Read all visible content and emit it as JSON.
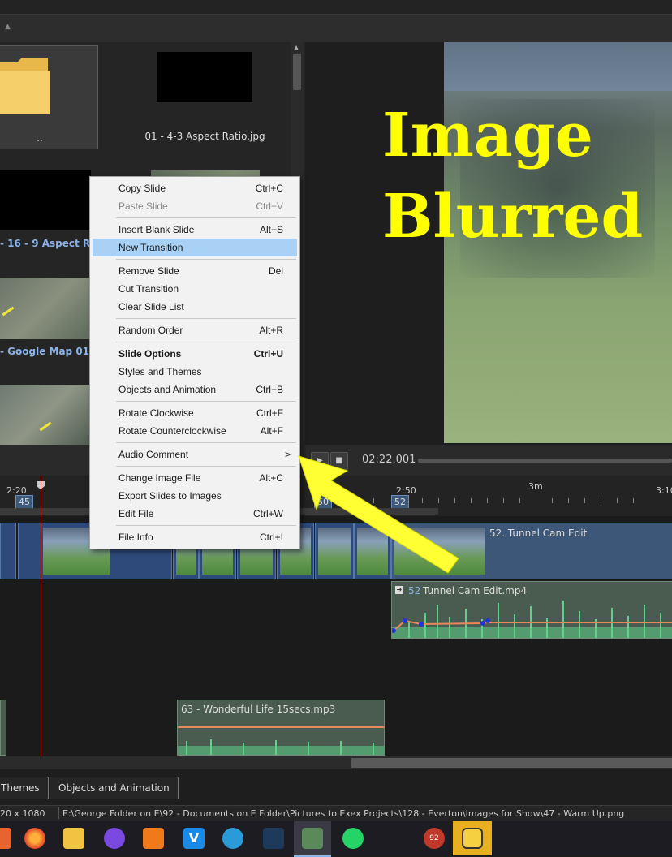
{
  "browser": {
    "tiles": [
      {
        "caption": ".."
      },
      {
        "caption": "01 - 4-3 Aspect Ratio.jpg"
      },
      {
        "caption": "- 16 - 9 Aspect Rati..."
      },
      {
        "caption": "- Google Map 01 L..."
      }
    ]
  },
  "preview": {
    "line1": "Image",
    "line2": "Blurred"
  },
  "player": {
    "timecode": "02:22.001",
    "play_icon": "play-icon",
    "stop_icon": "stop-icon"
  },
  "ruler": {
    "labels": [
      "2:20",
      "2:50",
      "3m",
      "3:10"
    ],
    "markers": [
      "45",
      "50",
      "52"
    ]
  },
  "timeline": {
    "slide_52_title": "52. Tunnel Cam Edit",
    "video_clip_number": "52",
    "video_clip_name": "Tunnel Cam Edit.mp4",
    "music_clip": "63 - Wonderful Life 15secs.mp3"
  },
  "bottom_tabs": {
    "themes": "Themes",
    "objects": "Objects and Animation"
  },
  "status": {
    "resolution": "20 x 1080",
    "path": "E:\\George Folder on E\\92 - Documents on E Folder\\Pictures to Exex Projects\\128 - Everton\\Images for Show\\47 - Warm Up.png"
  },
  "context_menu": {
    "items": [
      {
        "label": "Copy Slide",
        "shortcut": "Ctrl+C"
      },
      {
        "label": "Paste Slide",
        "shortcut": "Ctrl+V"
      },
      {
        "label": "Insert Blank Slide",
        "shortcut": "Alt+S"
      },
      {
        "label": "New Transition",
        "shortcut": ""
      },
      {
        "label": "Remove Slide",
        "shortcut": "Del"
      },
      {
        "label": "Cut Transition",
        "shortcut": ""
      },
      {
        "label": "Clear Slide List",
        "shortcut": ""
      },
      {
        "label": "Random Order",
        "shortcut": "Alt+R"
      },
      {
        "label": "Slide Options",
        "shortcut": "Ctrl+U"
      },
      {
        "label": "Styles and Themes",
        "shortcut": ""
      },
      {
        "label": "Objects and Animation",
        "shortcut": "Ctrl+B"
      },
      {
        "label": "Rotate Clockwise",
        "shortcut": "Ctrl+F"
      },
      {
        "label": "Rotate Counterclockwise",
        "shortcut": "Alt+F"
      },
      {
        "label": "Audio Comment",
        "shortcut": ">"
      },
      {
        "label": "Change Image File",
        "shortcut": "Alt+C"
      },
      {
        "label": "Export Slides to Images",
        "shortcut": ""
      },
      {
        "label": "Edit File",
        "shortcut": "Ctrl+W"
      },
      {
        "label": "File Info",
        "shortcut": "Ctrl+I"
      }
    ]
  },
  "taskbar": {
    "badge": "92",
    "icons": [
      "app-icon",
      "firefox-icon",
      "file-explorer-icon",
      "app-icon",
      "app-icon",
      "app-icon",
      "app-icon",
      "app-icon",
      "pte-app-icon",
      "whatsapp-icon",
      "app-icon",
      "app-icon"
    ]
  },
  "colors": {
    "menu_highlight": "#a8d1f5",
    "headline": "#ffff00",
    "arrow": "#ffff33",
    "accent_blue": "#2e4a7a",
    "audio_wave": "#5fcf8a"
  }
}
